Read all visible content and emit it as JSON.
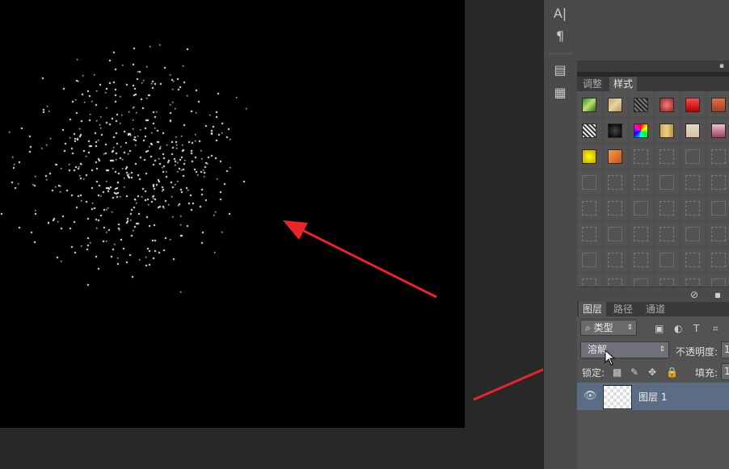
{
  "styles_panel": {
    "tabs": [
      "调整",
      "样式"
    ],
    "active_tab": "样式",
    "swatches_row1": [
      "green",
      "tan",
      "dark-texture",
      "red-texture",
      "red",
      "orange-brick"
    ],
    "swatches_row2": [
      "bw-stripes",
      "dark-dots",
      "rainbow",
      "wood",
      "beige",
      "pink"
    ],
    "swatches_row3": [
      "yellow",
      "orange-gradient"
    ]
  },
  "layers_panel": {
    "tabs": [
      "图层",
      "路径",
      "通道"
    ],
    "active_tab": "图层",
    "filter_kind": "类型",
    "blend_mode": "溶解",
    "opacity_label": "不透明度:",
    "opacity_value": "1",
    "lock_label": "锁定:",
    "fill_label": "填充:",
    "fill_value": "1",
    "layer_name": "图层 1"
  },
  "colors": {
    "panel_bg": "#535353",
    "canvas_bg": "#000000",
    "arrow_red": "#e8262a",
    "selected_layer": "#5b6d85"
  }
}
